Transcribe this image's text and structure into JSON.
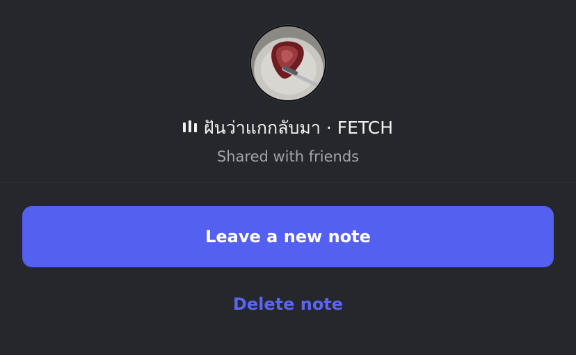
{
  "note": {
    "track_title": "ฝันว่าแกกลับมา",
    "separator": " · ",
    "artist": "FETCH",
    "audience": "Shared with friends"
  },
  "actions": {
    "primary_label": "Leave a new note",
    "delete_label": "Delete note"
  },
  "icons": {
    "now_playing": "equalizer-icon",
    "avatar": "profile-photo"
  },
  "colors": {
    "background": "#25272c",
    "accent": "#5461f0",
    "link": "#5a66f2",
    "secondary_text": "#a3a5ab"
  }
}
